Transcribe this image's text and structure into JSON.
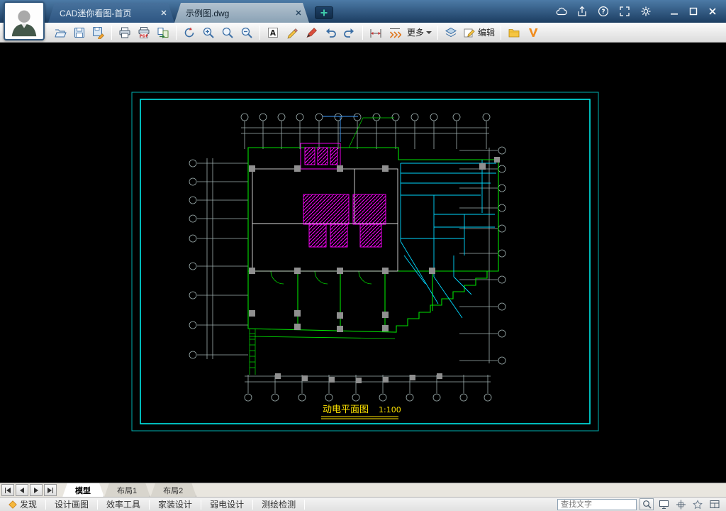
{
  "titlebar": {
    "home_tab": "CAD迷你看图-首页",
    "doc_tab": "示例图.dwg"
  },
  "toolbar": {
    "more": "更多",
    "edit": "编辑"
  },
  "drawing": {
    "title": "动电平面图",
    "scale": "1:100"
  },
  "sheet_bar": {
    "model": "模型",
    "layout1": "布局1",
    "layout2": "布局2"
  },
  "statusbar": {
    "discover": "发现",
    "items": [
      "设计画图",
      "效率工具",
      "家装设计",
      "弱电设计",
      "测绘检测"
    ],
    "search_placeholder": "查找文字"
  },
  "colors": {
    "titlebar_top": "#4c7aa6",
    "titlebar_bottom": "#1c3d61",
    "canvas_bg": "#000000",
    "frame_cyan": "#00e8e8",
    "wall_green": "#00e000",
    "hatch_magenta": "#ff00ff",
    "pipe_cyan": "#00d8ff",
    "label_yellow": "#ffe400",
    "v_logo_orange": "#f08c1e"
  }
}
